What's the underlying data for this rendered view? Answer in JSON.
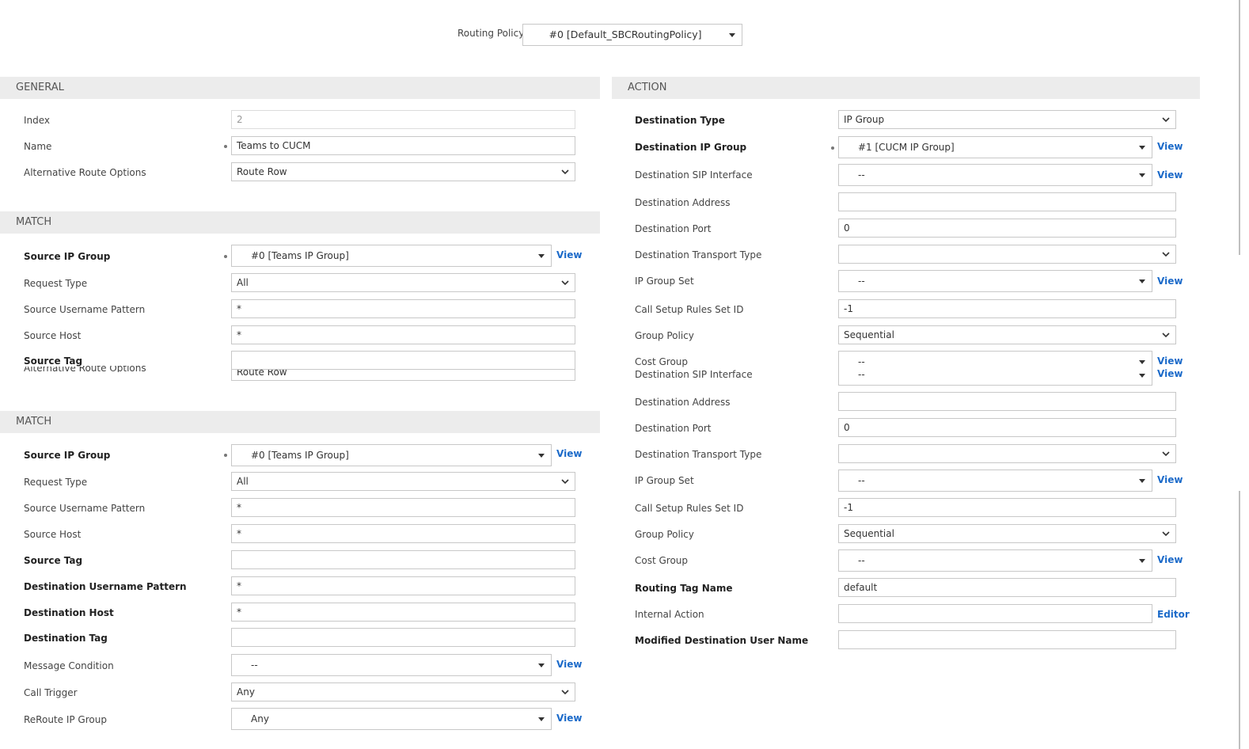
{
  "routing_policy": {
    "label": "Routing Policy",
    "value": "#0 [Default_SBCRoutingPolicy]"
  },
  "general": {
    "header": "GENERAL",
    "index": {
      "label": "Index",
      "value": "2"
    },
    "name": {
      "label": "Name",
      "value": "Teams to CUCM"
    },
    "alt_route": {
      "label": "Alternative Route Options",
      "value": "Route Row"
    }
  },
  "match_upper": {
    "header": "MATCH",
    "source_ip_group": {
      "label": "Source IP Group",
      "value": "#0 [Teams IP Group]",
      "link": "View"
    },
    "request_type": {
      "label": "Request Type",
      "value": "All"
    },
    "source_username_pattern": {
      "label": "Source Username Pattern",
      "value": "*"
    },
    "source_host": {
      "label": "Source Host",
      "value": "*"
    },
    "source_tag": {
      "label": "Source Tag",
      "value": ""
    },
    "ghost_alt_label": "Alternative Route Options",
    "ghost_alt_value": "Route Row"
  },
  "match": {
    "header": "MATCH",
    "source_ip_group": {
      "label": "Source IP Group",
      "value": "#0 [Teams IP Group]",
      "link": "View"
    },
    "request_type": {
      "label": "Request Type",
      "value": "All"
    },
    "source_username_pattern": {
      "label": "Source Username Pattern",
      "value": "*"
    },
    "source_host": {
      "label": "Source Host",
      "value": "*"
    },
    "source_tag": {
      "label": "Source Tag",
      "value": ""
    },
    "dest_username_pattern": {
      "label": "Destination Username Pattern",
      "value": "*"
    },
    "dest_host": {
      "label": "Destination Host",
      "value": "*"
    },
    "dest_tag": {
      "label": "Destination Tag",
      "value": ""
    },
    "message_condition": {
      "label": "Message Condition",
      "value": "--",
      "link": "View"
    },
    "call_trigger": {
      "label": "Call Trigger",
      "value": "Any"
    },
    "reroute_ip_group": {
      "label": "ReRoute IP Group",
      "value": "Any",
      "link": "View"
    }
  },
  "action": {
    "header": "ACTION",
    "dest_type": {
      "label": "Destination Type",
      "value": "IP Group"
    },
    "dest_ip_group": {
      "label": "Destination IP Group",
      "value": "#1 [CUCM IP Group]",
      "link": "View"
    },
    "dest_sip_interface": {
      "label": "Destination SIP Interface",
      "value": "--",
      "link": "View"
    },
    "dest_address": {
      "label": "Destination Address",
      "value": ""
    },
    "dest_port": {
      "label": "Destination Port",
      "value": "0"
    },
    "dest_transport_type": {
      "label": "Destination Transport Type",
      "value": ""
    },
    "ip_group_set": {
      "label": "IP Group Set",
      "value": "--",
      "link": "View"
    },
    "call_setup_rules": {
      "label": "Call Setup Rules Set ID",
      "value": "-1"
    },
    "group_policy": {
      "label": "Group Policy",
      "value": "Sequential"
    },
    "cost_group": {
      "label": "Cost Group",
      "value": "--",
      "link": "View"
    },
    "ghost_sip_label": "Destination SIP Interface",
    "ghost_sip_value": "--",
    "ghost_sip_link": "View"
  },
  "action_lower": {
    "dest_address": {
      "label": "Destination Address",
      "value": ""
    },
    "dest_port": {
      "label": "Destination Port",
      "value": "0"
    },
    "dest_transport_type": {
      "label": "Destination Transport Type",
      "value": ""
    },
    "ip_group_set": {
      "label": "IP Group Set",
      "value": "--",
      "link": "View"
    },
    "call_setup_rules": {
      "label": "Call Setup Rules Set ID",
      "value": "-1"
    },
    "group_policy": {
      "label": "Group Policy",
      "value": "Sequential"
    },
    "cost_group": {
      "label": "Cost Group",
      "value": "--",
      "link": "View"
    },
    "routing_tag_name": {
      "label": "Routing Tag Name",
      "value": "default"
    },
    "internal_action": {
      "label": "Internal Action",
      "value": "",
      "link": "Editor"
    },
    "modified_dest_user": {
      "label": "Modified Destination User Name",
      "value": ""
    }
  }
}
